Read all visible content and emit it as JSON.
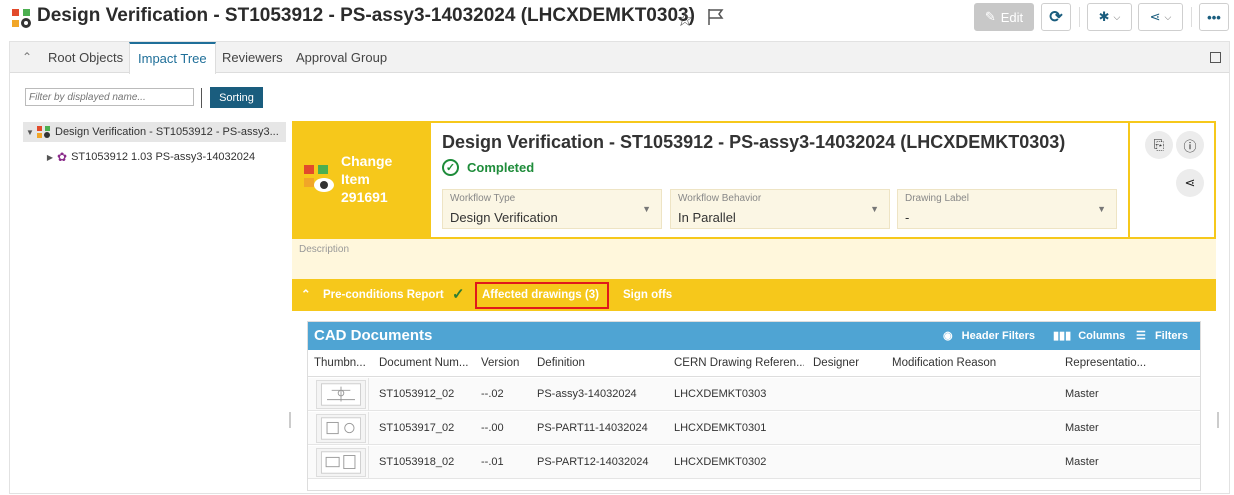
{
  "header": {
    "title": "Design Verification - ST1053912 - PS-assy3-14032024 (LHCXDEMKT0303)",
    "edit_label": "Edit",
    "more_label": "•••"
  },
  "tabs": [
    "Root Objects",
    "Impact Tree",
    "Reviewers",
    "Approval Group"
  ],
  "filter": {
    "placeholder": "Filter by displayed name...",
    "sort_label": "Sorting"
  },
  "tree": {
    "root": "Design Verification - ST1053912 - PS-assy3...",
    "child": "ST1053912 1.03 PS-assy3-14032024"
  },
  "change_item": {
    "line1": "Change",
    "line2": "Item",
    "line3": "291691"
  },
  "detail": {
    "title": "Design Verification - ST1053912 - PS-assy3-14032024 (LHCXDEMKT0303)",
    "status": "Completed",
    "fields": [
      {
        "label": "Workflow Type",
        "value": "Design Verification"
      },
      {
        "label": "Workflow Behavior",
        "value": "In Parallel"
      },
      {
        "label": "Drawing Label",
        "value": "-"
      }
    ],
    "description_label": "Description"
  },
  "subtabs": {
    "preconditions": "Pre-conditions Report",
    "affected": "Affected drawings (3)",
    "signoffs": "Sign offs"
  },
  "cad": {
    "title": "CAD Documents",
    "actions": {
      "header_filters": "Header Filters",
      "columns": "Columns",
      "filters": "Filters"
    },
    "columns": [
      "Thumbn...",
      "Document Num...",
      "Version",
      "Definition",
      "CERN Drawing Referen...",
      "Designer",
      "Modification Reason",
      "Representatio..."
    ],
    "rows": [
      {
        "doc": "ST1053912_02",
        "version": "--.02",
        "definition": "PS-assy3-14032024",
        "cern": "LHCXDEMKT0303",
        "designer": "",
        "reason": "",
        "rep": "Master"
      },
      {
        "doc": "ST1053917_02",
        "version": "--.00",
        "definition": "PS-PART11-14032024",
        "cern": "LHCXDEMKT0301",
        "designer": "",
        "reason": "",
        "rep": "Master"
      },
      {
        "doc": "ST1053918_02",
        "version": "--.01",
        "definition": "PS-PART12-14032024",
        "cern": "LHCXDEMKT0302",
        "designer": "",
        "reason": "",
        "rep": "Master"
      }
    ]
  },
  "colors": {
    "accent": "#f6c81b",
    "tab_active": "#1f6f99",
    "cad_header": "#4fa4d3",
    "status_green": "#1e8c3a",
    "highlight": "#e0191b"
  }
}
